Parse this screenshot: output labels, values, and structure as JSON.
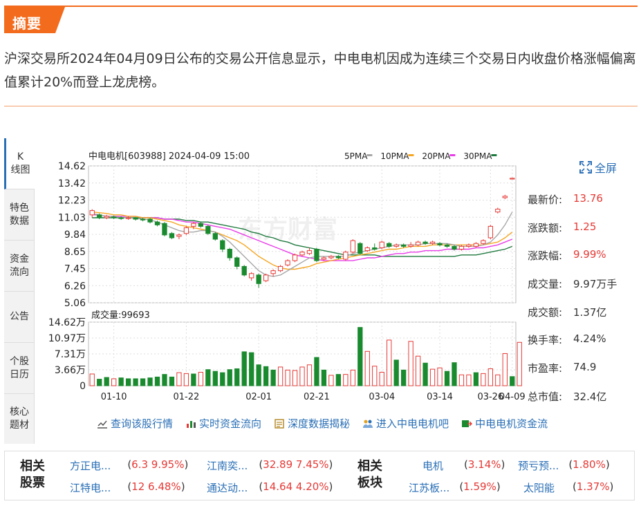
{
  "header": {
    "tag": "摘要",
    "summary": "沪深交易所2024年04月09日公布的交易公开信息显示，中电电机因成为连续三个交易日内收盘价格涨幅偏离值累计20%而登上龙虎榜。"
  },
  "tabs": [
    {
      "label": "K\n线图"
    },
    {
      "label": "特色\n数据"
    },
    {
      "label": "资金\n流向"
    },
    {
      "label": "公告"
    },
    {
      "label": "个股\n日历"
    },
    {
      "label": "核心\n题材"
    }
  ],
  "chart": {
    "title": "中电电机[603988] 2024-04-09 15:00",
    "ma_legend": [
      {
        "label": "5PMA",
        "color": "#a6a6a6"
      },
      {
        "label": "10PMA",
        "color": "#f5a623"
      },
      {
        "label": "20PMA",
        "color": "#e83ce8"
      },
      {
        "label": "30PMA",
        "color": "#1f7a3e"
      }
    ],
    "watermark": "东方财富",
    "volume_title": "成交量:99693"
  },
  "chart_data": [
    {
      "type": "candlestick",
      "title": "中电电机[603988] 2024-04-09 15:00",
      "y_ticks": [
        "14.62",
        "13.42",
        "12.23",
        "11.03",
        "9.84",
        "8.65",
        "7.45",
        "6.26",
        "5.06"
      ],
      "ylim": [
        5.06,
        14.62
      ],
      "x_ticks": [
        "01-10",
        "01-22",
        "02-01",
        "02-21",
        "03-04",
        "03-14",
        "03-26",
        "04-09"
      ],
      "candles": [
        {
          "o": 11.2,
          "c": 11.5,
          "h": 11.6,
          "l": 11.0
        },
        {
          "o": 11.2,
          "c": 11.0,
          "h": 11.3,
          "l": 10.9
        },
        {
          "o": 11.0,
          "c": 11.1,
          "h": 11.2,
          "l": 10.9
        },
        {
          "o": 11.05,
          "c": 11.0,
          "h": 11.15,
          "l": 10.9
        },
        {
          "o": 11.0,
          "c": 10.95,
          "h": 11.1,
          "l": 10.85
        },
        {
          "o": 10.95,
          "c": 11.0,
          "h": 11.1,
          "l": 10.85
        },
        {
          "o": 11.0,
          "c": 10.9,
          "h": 11.05,
          "l": 10.8
        },
        {
          "o": 10.9,
          "c": 10.85,
          "h": 11.0,
          "l": 10.75
        },
        {
          "o": 10.9,
          "c": 10.7,
          "h": 11.0,
          "l": 10.6
        },
        {
          "o": 10.7,
          "c": 10.5,
          "h": 10.8,
          "l": 10.4
        },
        {
          "o": 10.6,
          "c": 9.8,
          "h": 10.7,
          "l": 9.7
        },
        {
          "o": 9.9,
          "c": 9.6,
          "h": 10.0,
          "l": 9.5
        },
        {
          "o": 9.7,
          "c": 9.8,
          "h": 9.9,
          "l": 9.5
        },
        {
          "o": 9.9,
          "c": 10.3,
          "h": 10.4,
          "l": 9.8
        },
        {
          "o": 10.4,
          "c": 10.6,
          "h": 10.7,
          "l": 10.2
        },
        {
          "o": 10.6,
          "c": 10.4,
          "h": 10.7,
          "l": 10.3
        },
        {
          "o": 10.4,
          "c": 9.9,
          "h": 10.5,
          "l": 9.8
        },
        {
          "o": 9.9,
          "c": 9.5,
          "h": 10.0,
          "l": 9.4
        },
        {
          "o": 9.4,
          "c": 8.8,
          "h": 9.5,
          "l": 8.6
        },
        {
          "o": 8.8,
          "c": 8.2,
          "h": 8.9,
          "l": 8.0
        },
        {
          "o": 8.2,
          "c": 7.6,
          "h": 8.3,
          "l": 7.4
        },
        {
          "o": 7.6,
          "c": 7.0,
          "h": 7.7,
          "l": 6.9
        },
        {
          "o": 6.8,
          "c": 7.1,
          "h": 7.2,
          "l": 6.6
        },
        {
          "o": 7.0,
          "c": 6.4,
          "h": 7.1,
          "l": 6.1
        },
        {
          "o": 6.6,
          "c": 7.0,
          "h": 7.1,
          "l": 6.5
        },
        {
          "o": 7.1,
          "c": 7.3,
          "h": 7.4,
          "l": 6.9
        },
        {
          "o": 7.3,
          "c": 7.6,
          "h": 7.7,
          "l": 7.2
        },
        {
          "o": 7.7,
          "c": 8.0,
          "h": 8.1,
          "l": 7.6
        },
        {
          "o": 8.0,
          "c": 8.4,
          "h": 8.5,
          "l": 7.9
        },
        {
          "o": 8.4,
          "c": 8.6,
          "h": 8.7,
          "l": 8.3
        },
        {
          "o": 8.5,
          "c": 8.7,
          "h": 8.9,
          "l": 8.4
        },
        {
          "o": 8.8,
          "c": 8.0,
          "h": 8.9,
          "l": 7.9
        },
        {
          "o": 8.1,
          "c": 8.2,
          "h": 8.3,
          "l": 8.0
        },
        {
          "o": 8.2,
          "c": 8.3,
          "h": 8.4,
          "l": 8.1
        },
        {
          "o": 8.3,
          "c": 8.2,
          "h": 8.4,
          "l": 8.1
        },
        {
          "o": 8.1,
          "c": 8.6,
          "h": 8.7,
          "l": 8.0
        },
        {
          "o": 8.6,
          "c": 9.4,
          "h": 9.5,
          "l": 8.5
        },
        {
          "o": 9.2,
          "c": 8.5,
          "h": 9.3,
          "l": 8.4
        },
        {
          "o": 8.7,
          "c": 8.9,
          "h": 9.0,
          "l": 8.6
        },
        {
          "o": 8.9,
          "c": 8.8,
          "h": 9.2,
          "l": 8.7
        },
        {
          "o": 8.9,
          "c": 9.3,
          "h": 9.4,
          "l": 8.8
        },
        {
          "o": 9.2,
          "c": 9.0,
          "h": 9.3,
          "l": 8.9
        },
        {
          "o": 9.0,
          "c": 9.1,
          "h": 9.2,
          "l": 8.9
        },
        {
          "o": 9.1,
          "c": 9.0,
          "h": 9.2,
          "l": 8.9
        },
        {
          "o": 9.0,
          "c": 9.1,
          "h": 9.3,
          "l": 8.9
        },
        {
          "o": 9.1,
          "c": 9.3,
          "h": 9.4,
          "l": 9.0
        },
        {
          "o": 9.3,
          "c": 9.2,
          "h": 9.4,
          "l": 9.1
        },
        {
          "o": 9.2,
          "c": 9.3,
          "h": 9.4,
          "l": 9.1
        },
        {
          "o": 9.2,
          "c": 9.1,
          "h": 9.3,
          "l": 9.0
        },
        {
          "o": 9.1,
          "c": 9.0,
          "h": 9.2,
          "l": 8.9
        },
        {
          "o": 9.0,
          "c": 8.8,
          "h": 9.1,
          "l": 8.7
        },
        {
          "o": 8.8,
          "c": 9.0,
          "h": 9.1,
          "l": 8.7
        },
        {
          "o": 9.0,
          "c": 9.1,
          "h": 9.2,
          "l": 8.9
        },
        {
          "o": 9.0,
          "c": 9.2,
          "h": 9.3,
          "l": 8.9
        },
        {
          "o": 9.2,
          "c": 9.4,
          "h": 9.5,
          "l": 9.1
        },
        {
          "o": 9.6,
          "c": 10.4,
          "h": 10.5,
          "l": 9.5
        },
        {
          "o": 11.4,
          "c": 11.6,
          "h": 11.7,
          "l": 11.3
        },
        {
          "o": 12.4,
          "c": 12.5,
          "h": 12.6,
          "l": 12.3
        },
        {
          "o": 13.7,
          "c": 13.76,
          "h": 13.8,
          "l": 13.7
        }
      ],
      "ma5": [
        11.3,
        11.2,
        11.1,
        11.1,
        11.0,
        11.0,
        10.95,
        10.9,
        10.85,
        10.7,
        10.5,
        10.3,
        10.1,
        10.0,
        10.0,
        10.1,
        10.1,
        10.0,
        9.7,
        9.3,
        8.8,
        8.3,
        7.8,
        7.3,
        7.0,
        6.9,
        7.0,
        7.3,
        7.6,
        7.9,
        8.2,
        8.3,
        8.3,
        8.3,
        8.3,
        8.3,
        8.5,
        8.6,
        8.7,
        8.8,
        8.9,
        9.0,
        9.1,
        9.1,
        9.1,
        9.1,
        9.2,
        9.2,
        9.2,
        9.2,
        9.1,
        9.0,
        9.0,
        9.0,
        9.1,
        9.3,
        9.8,
        10.5,
        11.4
      ],
      "ma10": [
        11.4,
        11.35,
        11.3,
        11.2,
        11.2,
        11.1,
        11.1,
        11.0,
        11.0,
        10.9,
        10.8,
        10.7,
        10.5,
        10.4,
        10.3,
        10.2,
        10.1,
        10.0,
        9.8,
        9.6,
        9.4,
        9.1,
        8.7,
        8.3,
        8.0,
        7.7,
        7.5,
        7.4,
        7.4,
        7.5,
        7.6,
        7.8,
        7.9,
        8.0,
        8.1,
        8.2,
        8.3,
        8.4,
        8.5,
        8.6,
        8.7,
        8.8,
        8.8,
        8.9,
        9.0,
        9.0,
        9.0,
        9.1,
        9.1,
        9.1,
        9.1,
        9.1,
        9.1,
        9.1,
        9.1,
        9.2,
        9.3,
        9.6,
        10.0
      ],
      "ma20": [
        11.2,
        11.2,
        11.1,
        11.1,
        11.1,
        11.1,
        11.1,
        11.0,
        11.0,
        11.0,
        10.9,
        10.9,
        10.8,
        10.7,
        10.7,
        10.6,
        10.5,
        10.4,
        10.3,
        10.2,
        10.0,
        9.8,
        9.6,
        9.4,
        9.2,
        9.0,
        8.8,
        8.6,
        8.4,
        8.3,
        8.2,
        8.1,
        8.0,
        8.0,
        8.0,
        8.0,
        8.0,
        8.1,
        8.2,
        8.2,
        8.3,
        8.4,
        8.5,
        8.5,
        8.6,
        8.6,
        8.7,
        8.7,
        8.7,
        8.8,
        8.8,
        8.8,
        8.8,
        8.9,
        8.9,
        9.0,
        9.1,
        9.3,
        9.5
      ],
      "ma30": [
        11.0,
        11.0,
        11.0,
        11.0,
        11.0,
        11.0,
        11.0,
        11.0,
        11.0,
        11.0,
        10.9,
        10.9,
        10.9,
        10.8,
        10.8,
        10.7,
        10.7,
        10.6,
        10.5,
        10.4,
        10.3,
        10.2,
        10.0,
        9.9,
        9.7,
        9.6,
        9.4,
        9.3,
        9.1,
        9.0,
        8.9,
        8.8,
        8.7,
        8.6,
        8.5,
        8.4,
        8.4,
        8.4,
        8.4,
        8.4,
        8.3,
        8.3,
        8.3,
        8.3,
        8.3,
        8.3,
        8.3,
        8.3,
        8.3,
        8.3,
        8.3,
        8.4,
        8.4,
        8.4,
        8.5,
        8.6,
        8.7,
        8.8,
        9.0
      ]
    },
    {
      "type": "bar",
      "title": "成交量:99693",
      "y_ticks": [
        "14.62万",
        "10.97万",
        "7.31万",
        "3.66万",
        "0"
      ],
      "ylim": [
        0,
        14.62
      ],
      "values": [
        2.7,
        1.5,
        1.9,
        1.6,
        1.8,
        1.6,
        1.6,
        1.6,
        1.8,
        2.0,
        2.6,
        2.0,
        3.0,
        2.8,
        2.7,
        3.1,
        3.7,
        3.3,
        3.0,
        3.7,
        3.9,
        7.8,
        7.6,
        4.8,
        4.4,
        3.6,
        4.3,
        3.6,
        3.5,
        4.3,
        4.8,
        6.5,
        3.6,
        2.4,
        2.6,
        2.6,
        3.6,
        13.4,
        7.9,
        4.5,
        3.1,
        10.5,
        5.9,
        3.6,
        10.2,
        6.8,
        5.2,
        3.8,
        4.1,
        3.3,
        5.3,
        2.5,
        2.5,
        3.0,
        2.8,
        3.9,
        2.5,
        7.4,
        2.1,
        9.97
      ],
      "up": [
        1,
        0,
        0,
        1,
        0,
        0,
        0,
        0,
        0,
        0,
        0,
        0,
        1,
        1,
        0,
        1,
        0,
        0,
        0,
        0,
        0,
        0,
        0,
        0,
        0,
        0,
        1,
        1,
        1,
        1,
        1,
        0,
        0,
        1,
        0,
        1,
        1,
        0,
        1,
        1,
        1,
        1,
        0,
        0,
        1,
        1,
        0,
        1,
        1,
        0,
        0,
        1,
        1,
        0,
        1,
        1,
        1,
        1,
        0,
        1
      ]
    }
  ],
  "fullscreen": "全屏",
  "stats": [
    {
      "label": "最新价:",
      "value": "13.76",
      "red": true
    },
    {
      "label": "涨跌额:",
      "value": "1.25",
      "red": true
    },
    {
      "label": "涨跌幅:",
      "value": "9.99%",
      "red": true
    },
    {
      "label": "成交量:",
      "value": "9.97万手",
      "red": false
    },
    {
      "label": "成交额:",
      "value": "1.37亿",
      "red": false
    },
    {
      "label": "换手率:",
      "value": "4.24%",
      "red": false
    },
    {
      "label": "市盈率:",
      "value": "74.9",
      "red": false
    },
    {
      "label": "总市值:",
      "value": "32.4亿",
      "red": false
    }
  ],
  "links": [
    {
      "label": "查询该股行情",
      "icon": "line-chart-icon"
    },
    {
      "label": "实时资金流向",
      "icon": "bar-chart-icon"
    },
    {
      "label": "深度数据揭秘",
      "icon": "document-icon"
    },
    {
      "label": "进入中电电机吧",
      "icon": "users-icon"
    },
    {
      "label": "中电电机资金流",
      "icon": "flow-icon"
    }
  ],
  "related": {
    "stocks_head": "相关\n股票",
    "sectors_head": "相关\n板块",
    "stocks": [
      {
        "name": "方正电...",
        "value": "6.3 9.95%"
      },
      {
        "name": "江南奕...",
        "value": "32.89 7.45%"
      },
      {
        "name": "江特电...",
        "value": "12 6.48%"
      },
      {
        "name": "通达动...",
        "value": "14.64 4.20%"
      }
    ],
    "sectors": [
      {
        "name": "电机",
        "value": "3.14%"
      },
      {
        "name": "预亏预...",
        "value": "1.80%"
      },
      {
        "name": "江苏板...",
        "value": "1.59%"
      },
      {
        "name": "太阳能",
        "value": "1.37%"
      }
    ]
  }
}
